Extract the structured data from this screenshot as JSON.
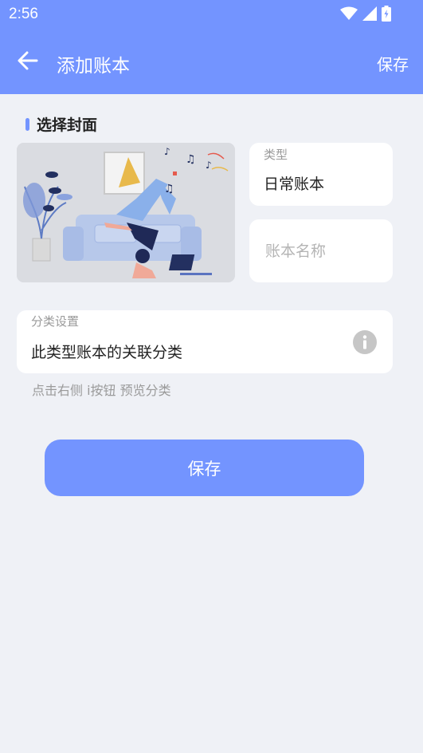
{
  "status_bar": {
    "time": "2:56"
  },
  "app_bar": {
    "title": "添加账本",
    "save_label": "保存"
  },
  "cover_section": {
    "title": "选择封面"
  },
  "type_field": {
    "label": "类型",
    "value": "日常账本"
  },
  "name_field": {
    "placeholder": "账本名称",
    "value": ""
  },
  "category_field": {
    "label": "分类设置",
    "value": "此类型账本的关联分类"
  },
  "hint": "点击右侧 i按钮 预览分类",
  "primary_button": {
    "label": "保存"
  },
  "colors": {
    "accent": "#7394ff",
    "background": "#eff1f6",
    "card": "#ffffff"
  }
}
